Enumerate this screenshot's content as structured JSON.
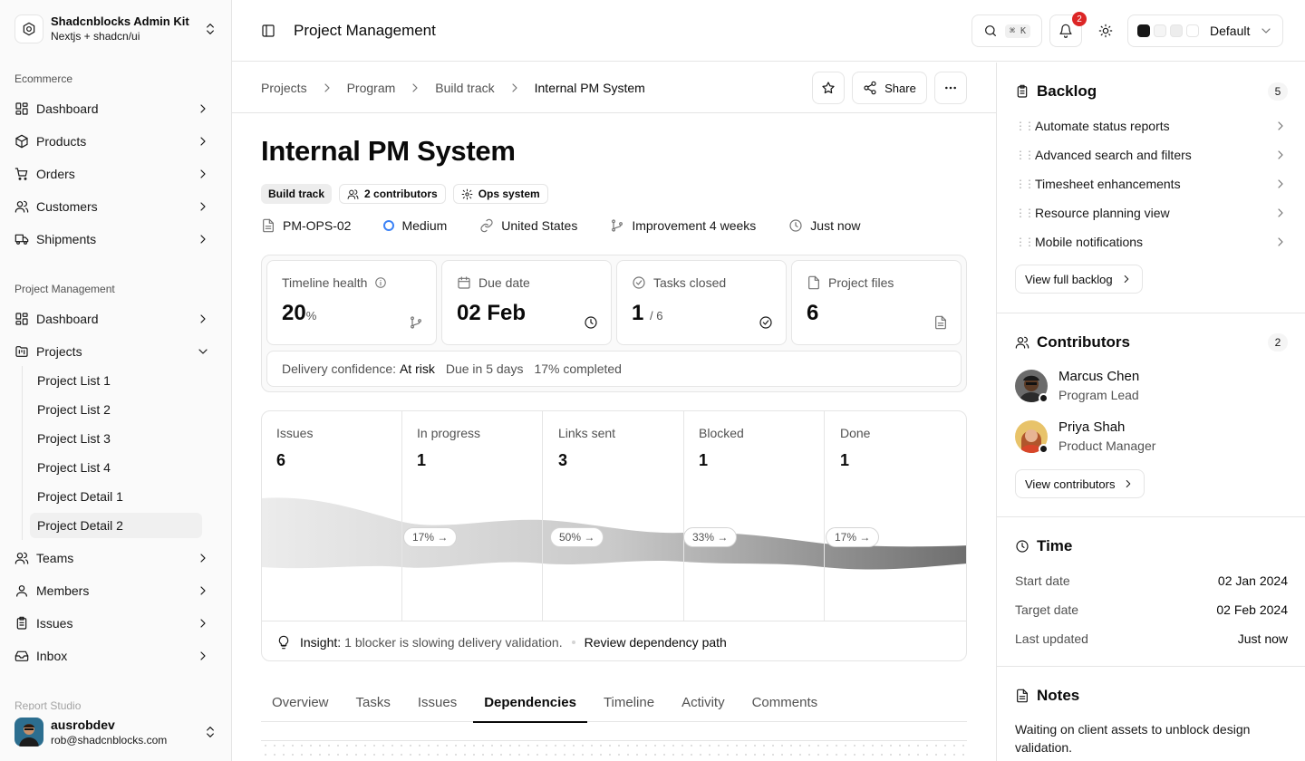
{
  "brand": {
    "title": "Shadcnblocks Admin Kit",
    "subtitle": "Nextjs + shadcn/ui"
  },
  "sidebar": {
    "section1": "Ecommerce",
    "ecommerce": [
      "Dashboard",
      "Products",
      "Orders",
      "Customers",
      "Shipments"
    ],
    "section2": "Project Management",
    "pm": {
      "dashboard": "Dashboard",
      "projects": "Projects"
    },
    "projects_sub": [
      "Project List 1",
      "Project List 2",
      "Project List 3",
      "Project List 4",
      "Project Detail 1",
      "Project Detail 2"
    ],
    "more": [
      "Teams",
      "Members",
      "Issues",
      "Inbox"
    ],
    "faded_label": "Report Studio"
  },
  "user": {
    "name": "ausrobdev",
    "email": "rob@shadcnblocks.com"
  },
  "header": {
    "title": "Project Management",
    "kbd": "⌘ K",
    "notifications": "2",
    "theme": "Default"
  },
  "breadcrumb": [
    "Projects",
    "Program",
    "Build track",
    "Internal PM System"
  ],
  "actions": {
    "share": "Share"
  },
  "project": {
    "title": "Internal PM System",
    "tags": {
      "track": "Build track",
      "contributors": "2 contributors",
      "system": "Ops system"
    },
    "meta": {
      "id": "PM-OPS-02",
      "priority": "Medium",
      "region": "United States",
      "type": "Improvement 4 weeks",
      "updated": "Just now"
    }
  },
  "stats": {
    "timeline": {
      "label": "Timeline health",
      "value": "20",
      "unit": "%"
    },
    "due": {
      "label": "Due date",
      "value": "02 Feb"
    },
    "tasks": {
      "label": "Tasks closed",
      "value": "1",
      "total": "/ 6"
    },
    "files": {
      "label": "Project files",
      "value": "6"
    }
  },
  "confidence": {
    "label": "Delivery confidence:",
    "status": "At risk",
    "due": "Due in 5 days",
    "completed": "17% completed"
  },
  "funnel": {
    "stages": [
      {
        "label": "Issues",
        "value": "6"
      },
      {
        "label": "In progress",
        "value": "1"
      },
      {
        "label": "Links sent",
        "value": "3"
      },
      {
        "label": "Blocked",
        "value": "1"
      },
      {
        "label": "Done",
        "value": "1"
      }
    ],
    "rates": [
      "17% →",
      "50% →",
      "33% →",
      "17% →"
    ]
  },
  "insight": {
    "label": "Insight:",
    "text": "1 blocker is slowing delivery validation.",
    "action": "Review dependency path"
  },
  "tabs": [
    "Overview",
    "Tasks",
    "Issues",
    "Dependencies",
    "Timeline",
    "Activity",
    "Comments"
  ],
  "active_tab": "Dependencies",
  "backlog": {
    "title": "Backlog",
    "count": "5",
    "items": [
      "Automate status reports",
      "Advanced search and filters",
      "Timesheet enhancements",
      "Resource planning view",
      "Mobile notifications"
    ],
    "button": "View full backlog"
  },
  "contributors": {
    "title": "Contributors",
    "count": "2",
    "people": [
      {
        "name": "Marcus Chen",
        "role": "Program Lead"
      },
      {
        "name": "Priya Shah",
        "role": "Product Manager"
      }
    ],
    "button": "View contributors"
  },
  "time": {
    "title": "Time",
    "rows": [
      {
        "k": "Start date",
        "v": "02 Jan 2024"
      },
      {
        "k": "Target date",
        "v": "02 Feb 2024"
      },
      {
        "k": "Last updated",
        "v": "Just now"
      }
    ]
  },
  "notes": {
    "title": "Notes",
    "text": "Waiting on client assets to unblock design validation."
  }
}
